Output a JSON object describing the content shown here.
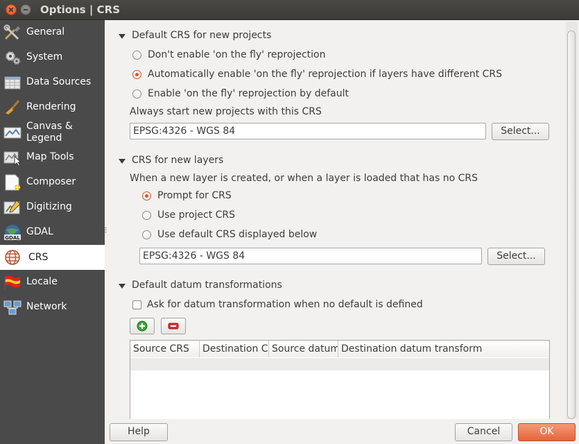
{
  "window": {
    "title": "Options | CRS"
  },
  "sidebar": {
    "items": [
      {
        "label": "General",
        "icon": "tools-icon"
      },
      {
        "label": "System",
        "icon": "gears-icon"
      },
      {
        "label": "Data Sources",
        "icon": "table-icon"
      },
      {
        "label": "Rendering",
        "icon": "paintbrush-icon"
      },
      {
        "label": "Canvas & Legend",
        "label_line1": "Canvas &",
        "label_line2": "Legend",
        "icon": "canvas-legend-icon"
      },
      {
        "label": "Map Tools",
        "icon": "map-tools-icon"
      },
      {
        "label": "Composer",
        "icon": "composer-icon"
      },
      {
        "label": "Digitizing",
        "icon": "digitizing-icon"
      },
      {
        "label": "GDAL",
        "icon": "gdal-icon"
      },
      {
        "label": "CRS",
        "icon": "globe-icon",
        "selected": true
      },
      {
        "label": "Locale",
        "icon": "flag-icon"
      },
      {
        "label": "Network",
        "icon": "network-icon"
      }
    ]
  },
  "default_crs": {
    "heading": "Default CRS for new projects",
    "options": [
      {
        "label": "Don't enable 'on the fly' reprojection",
        "checked": false
      },
      {
        "label": "Automatically enable 'on the fly' reprojection if layers have different CRS",
        "checked": true
      },
      {
        "label": "Enable 'on the fly' reprojection by default",
        "checked": false
      }
    ],
    "always_label": "Always start new projects with this CRS",
    "crs_value": "EPSG:4326 - WGS 84",
    "select_label": "Select..."
  },
  "crs_new_layers": {
    "heading": "CRS for new layers",
    "description": "When a new layer is created, or when a layer is loaded that has no CRS",
    "options": [
      {
        "label": "Prompt for CRS",
        "checked": true
      },
      {
        "label": "Use project CRS",
        "checked": false
      },
      {
        "label": "Use default CRS displayed below",
        "checked": false
      }
    ],
    "crs_value": "EPSG:4326 - WGS 84",
    "select_label": "Select..."
  },
  "datum": {
    "heading": "Default datum transformations",
    "ask_label": "Ask for datum transformation when no default is defined",
    "ask_checked": false,
    "add_icon": "plus-icon",
    "remove_icon": "minus-icon",
    "columns": [
      "Source CRS",
      "Destination CRS",
      "Source datum",
      "Destination datum transform"
    ],
    "rows": []
  },
  "footer": {
    "help_label": "Help",
    "cancel_label": "Cancel",
    "ok_label": "OK"
  },
  "colors": {
    "accent": "#e4653b",
    "sidebar_bg": "#4a4a4a",
    "titlebar_bg": "#3c3b37"
  }
}
